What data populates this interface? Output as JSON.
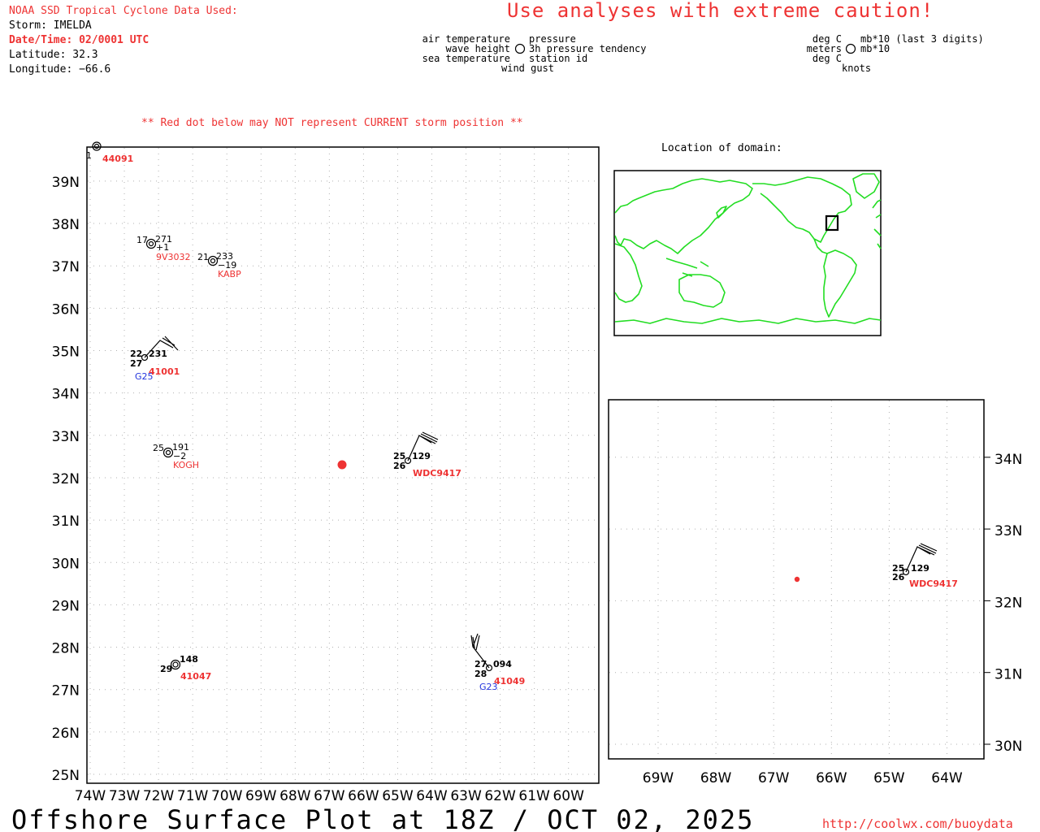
{
  "header": {
    "source_line": "NOAA SSD Tropical Cyclone Data Used:",
    "storm": "Storm: IMELDA",
    "datetime": "Date/Time: 02/0001 UTC",
    "latitude": "Latitude: 32.3",
    "longitude": "Longitude: −66.6",
    "caution": "Use analyses with extreme caution!"
  },
  "legend": {
    "left_col": [
      "air temperature",
      "wave height",
      "sea temperature"
    ],
    "right_col": [
      "pressure",
      "3h pressure tendency",
      "station id"
    ],
    "bottom": "wind gust",
    "units_left": [
      "deg C",
      "meters",
      "deg C"
    ],
    "units_right": [
      "mb*10 (last 3 digits)",
      "mb*10"
    ],
    "units_bottom": "knots"
  },
  "warning": "** Red dot below may NOT represent CURRENT storm position **",
  "inset_title": "Location of domain:",
  "footer": {
    "title": "Offshore Surface Plot at 18Z / OCT 02, 2025",
    "url": "http://coolwx.com/buoydata"
  },
  "colors": {
    "station_id": "#ee3333",
    "storm_dot": "#ee3333",
    "coastline": "#22dd22",
    "gust_label": "#2233dd"
  },
  "main_map": {
    "lon_ticks": [
      "74W",
      "73W",
      "72W",
      "71W",
      "70W",
      "69W",
      "68W",
      "67W",
      "66W",
      "65W",
      "64W",
      "63W",
      "62W",
      "61W",
      "60W"
    ],
    "lat_ticks": [
      "25N",
      "26N",
      "27N",
      "28N",
      "29N",
      "30N",
      "31N",
      "32N",
      "33N",
      "34N",
      "35N",
      "36N",
      "37N",
      "38N",
      "39N"
    ],
    "storm_position": {
      "lat": 32.3,
      "lon": -66.6
    },
    "stations": [
      {
        "id": "44091",
        "air": "",
        "pressure": "",
        "tendency": "",
        "note": "partially cut off at top-left"
      },
      {
        "id": "9V3032",
        "air": "17",
        "pressure": "271",
        "tendency": "+1"
      },
      {
        "id": "KABP",
        "air": "21",
        "pressure": "233",
        "tendency": "−19"
      },
      {
        "id": "41001",
        "air": "22",
        "pressure": "231",
        "sea": "27",
        "gust": "G25"
      },
      {
        "id": "KOGH",
        "air": "25",
        "pressure": "191",
        "tendency": "−2"
      },
      {
        "id": "WDC9417",
        "air": "25",
        "pressure": "129",
        "sea": "26"
      },
      {
        "id": "41047",
        "pressure": "148",
        "sea": "29"
      },
      {
        "id": "41049",
        "air": "27",
        "pressure": "094",
        "sea": "28",
        "gust": "G23"
      }
    ]
  },
  "zoom_map": {
    "lon_ticks": [
      "69W",
      "68W",
      "67W",
      "66W",
      "65W",
      "64W"
    ],
    "lat_ticks": [
      "30N",
      "31N",
      "32N",
      "33N",
      "34N"
    ],
    "stations": [
      {
        "id": "WDC9417",
        "air": "25",
        "pressure": "129",
        "sea": "26"
      }
    ]
  }
}
